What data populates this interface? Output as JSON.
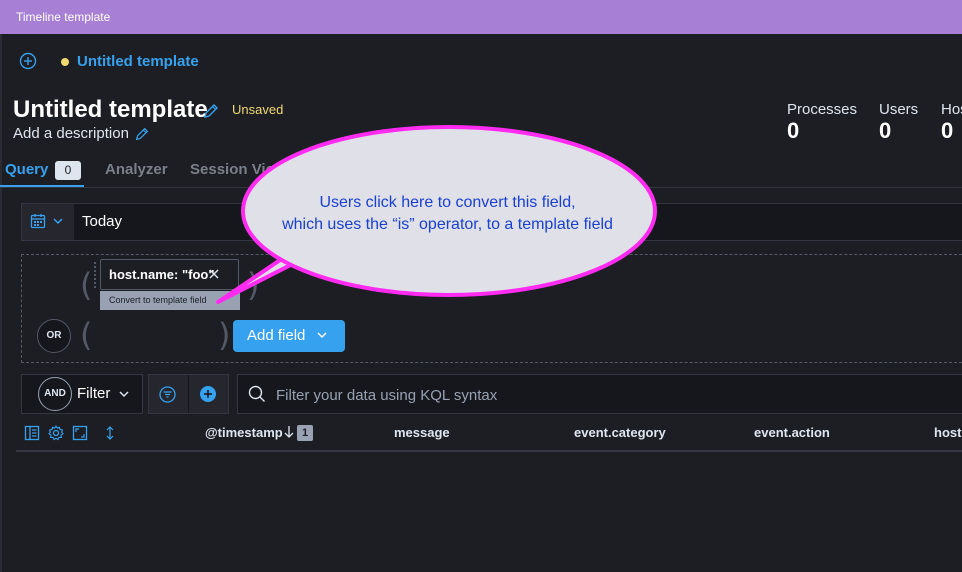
{
  "window": {
    "title": "Timeline template"
  },
  "header": {
    "tab_label": "Untitled template",
    "title": "Untitled template",
    "status": "Unsaved",
    "description_placeholder": "Add a description"
  },
  "stats": [
    {
      "label": "Processes",
      "value": "0"
    },
    {
      "label": "Users",
      "value": "0"
    },
    {
      "label": "Hos",
      "value": "0"
    }
  ],
  "tabs": [
    {
      "label": "Query",
      "count": "0",
      "active": true
    },
    {
      "label": "Analyzer",
      "active": false
    },
    {
      "label": "Session View",
      "active": false
    }
  ],
  "date_picker": {
    "value": "Today"
  },
  "query_builder": {
    "field_chip": "host.name: \"foo\"",
    "tooltip": "Convert to template field",
    "or_label": "OR",
    "add_field_label": "Add field"
  },
  "filter_bar": {
    "and_label": "AND",
    "filter_label": "Filter",
    "kql_placeholder": "Filter your data using KQL syntax"
  },
  "table": {
    "columns": [
      "@timestamp",
      "message",
      "event.category",
      "event.action",
      "host."
    ],
    "sort_index": "1"
  },
  "annotation": {
    "line1": "Users click here to convert this field,",
    "line2": "which uses the “is” operator, to a template field"
  },
  "colors": {
    "titlebar": "#a77fd4",
    "accent": "#36a2ef",
    "warning": "#f1d86f",
    "background": "#1d1e24",
    "callout_border": "#ff2bf1",
    "callout_text": "#1a3fd1"
  }
}
